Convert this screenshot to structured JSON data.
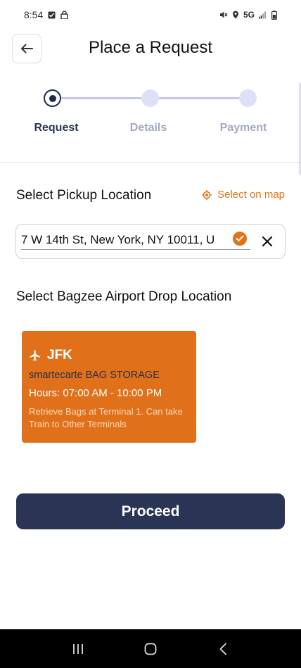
{
  "status_bar": {
    "time": "8:54",
    "network": "5G",
    "icons": [
      "checkbox-notification-icon",
      "lock-icon",
      "mute-icon",
      "location-icon",
      "signal-icon",
      "battery-icon"
    ]
  },
  "header": {
    "back_icon": "arrow-left-icon",
    "title": "Place a Request"
  },
  "stepper": {
    "steps": [
      {
        "label": "Request",
        "state": "active"
      },
      {
        "label": "Details",
        "state": "inactive"
      },
      {
        "label": "Payment",
        "state": "inactive"
      }
    ],
    "colors": {
      "active": "#1e2a4a",
      "inactive": "#dde0f6",
      "line": "#c5c9e6"
    }
  },
  "pickup": {
    "title": "Select Pickup Location",
    "map_link_label": "Select on map",
    "map_link_icon": "crosshair-location-icon",
    "address_value": "7 W 14th St, New York, NY 10011, U",
    "clear_icon": "close-icon",
    "verified_icon": "check-circle-icon"
  },
  "drop": {
    "title": "Select Bagzee Airport Drop Location",
    "cards": [
      {
        "code": "JFK",
        "icon": "airplane-icon",
        "name": "smartecarte BAG STORAGE",
        "hours": "Hours: 07:00 AM - 10:00 PM",
        "note": "Retrieve Bags at Terminal 1. Can take Train to Other Terminals"
      }
    ]
  },
  "actions": {
    "proceed_label": "Proceed"
  },
  "nav_bar": {
    "items": [
      "recent-apps-icon",
      "home-icon",
      "back-icon"
    ]
  },
  "colors": {
    "accent": "#e0731a",
    "primary": "#2a3555",
    "card_bg": "#e0711a"
  }
}
